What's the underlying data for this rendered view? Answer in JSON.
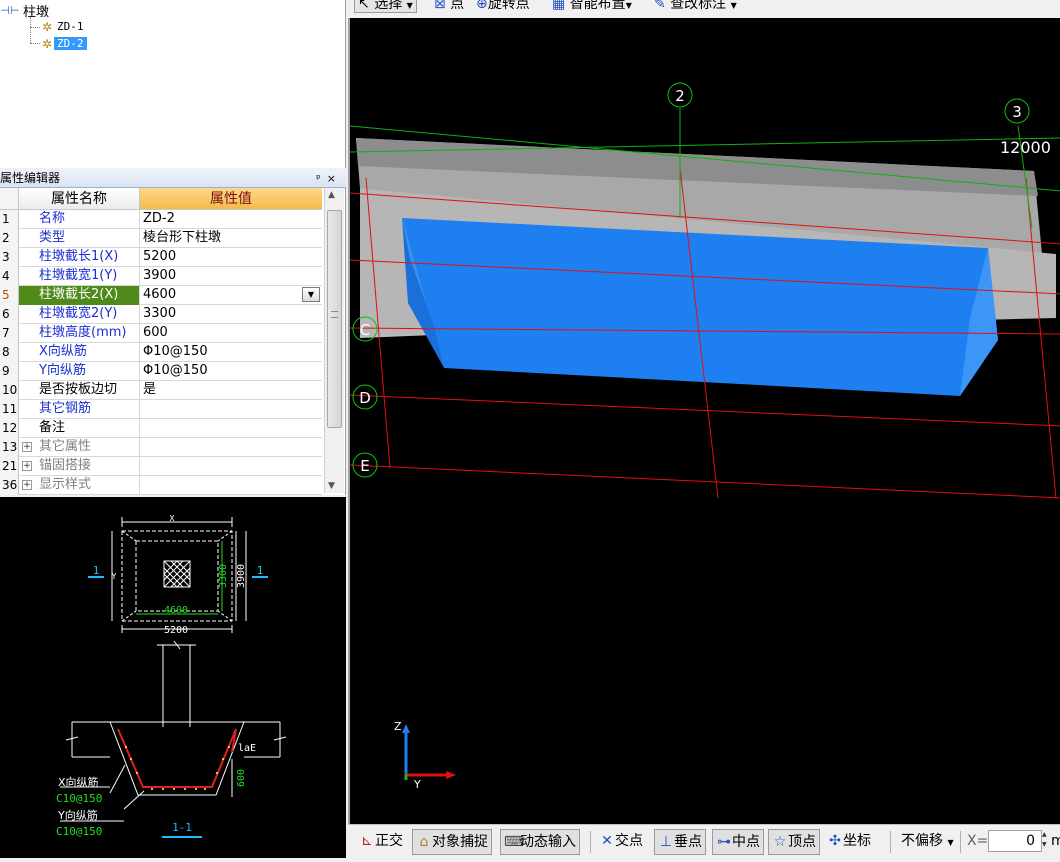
{
  "tree": {
    "root_label": "柱墩",
    "items": [
      {
        "label": "ZD-1",
        "selected": false
      },
      {
        "label": "ZD-2",
        "selected": true
      }
    ]
  },
  "property_editor": {
    "title": "属性编辑器",
    "pin_label": "ᵖ",
    "close_label": "×",
    "col_name": "属性名称",
    "col_value": "属性值",
    "rows": [
      {
        "num": "1",
        "name": "名称",
        "value": "ZD-2",
        "style": "blue"
      },
      {
        "num": "2",
        "name": "类型",
        "value": "棱台形下柱墩",
        "style": "blue"
      },
      {
        "num": "3",
        "name": "柱墩截长1(X)",
        "value": "5200",
        "style": "blue"
      },
      {
        "num": "4",
        "name": "柱墩截宽1(Y)",
        "value": "3900",
        "style": "blue"
      },
      {
        "num": "5",
        "name": "柱墩截长2(X)",
        "value": "4600",
        "style": "selected"
      },
      {
        "num": "6",
        "name": "柱墩截宽2(Y)",
        "value": "3300",
        "style": "blue"
      },
      {
        "num": "7",
        "name": "柱墩高度(mm)",
        "value": "600",
        "style": "blue"
      },
      {
        "num": "8",
        "name": "X向纵筋",
        "value": "Φ10@150",
        "style": "blue"
      },
      {
        "num": "9",
        "name": "Y向纵筋",
        "value": "Φ10@150",
        "style": "blue"
      },
      {
        "num": "10",
        "name": "是否按板边切",
        "value": "是",
        "style": "black"
      },
      {
        "num": "11",
        "name": "其它钢筋",
        "value": "",
        "style": "blue"
      },
      {
        "num": "12",
        "name": "备注",
        "value": "",
        "style": "black"
      },
      {
        "num": "13",
        "name": "其它属性",
        "value": "",
        "style": "group"
      },
      {
        "num": "21",
        "name": "锚固搭接",
        "value": "",
        "style": "group"
      },
      {
        "num": "36",
        "name": "显示样式",
        "value": "",
        "style": "group"
      }
    ]
  },
  "preview": {
    "plan": {
      "label_x": "X",
      "label_y": "Y",
      "dim_inner_x": "4600",
      "dim_outer_x": "5200",
      "dim_inner_y": "3300",
      "dim_outer_y": "3900",
      "section_mark": "1"
    },
    "section": {
      "label_lae": "laE",
      "dim_height": "600",
      "x_bar_label": "X向纵筋",
      "x_bar_spec": "C10@150",
      "y_bar_label": "Y向纵筋",
      "y_bar_spec": "C10@150",
      "section_title": "1-1"
    }
  },
  "top_toolbar": {
    "select": "选择",
    "point": "点",
    "rotate_point": "旋转点",
    "smart_layout": "智能布置",
    "check_annotation": "查改标注"
  },
  "viewport": {
    "axis_numbers": [
      "2",
      "3"
    ],
    "axis_letters": [
      "C",
      "D",
      "E"
    ],
    "dimension": "12000",
    "axis_z": "Z",
    "axis_y": "Y"
  },
  "bottom_toolbar": {
    "ortho": "正交",
    "object_snap": "对象捕捉",
    "dynamic_input": "动态输入",
    "intersection": "交点",
    "perpendicular": "垂点",
    "midpoint": "中点",
    "vertex": "顶点",
    "coordinate": "坐标",
    "offset_mode": "不偏移",
    "x_label": "X=",
    "x_value": "0",
    "unit": "m"
  },
  "colors": {
    "pier_blue": "#1e7ff0",
    "slab_gray": "#a9a9a9",
    "grid_red": "#e01010",
    "grid_green": "#10b010",
    "cad_white": "#ffffff",
    "cad_green": "#22dd22",
    "cad_cyan": "#22bbff"
  }
}
